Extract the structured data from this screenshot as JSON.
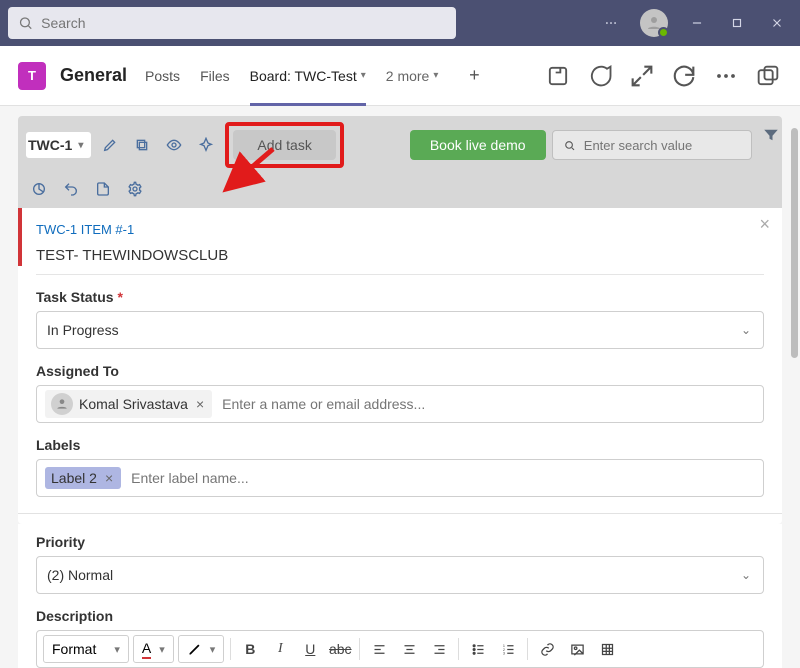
{
  "titlebar": {
    "search_placeholder": "Search"
  },
  "channel": {
    "icon_letter": "T",
    "name": "General",
    "tabs": {
      "posts": "Posts",
      "files": "Files",
      "board": "Board: TWC-Test",
      "more": "2 more"
    }
  },
  "toolbar": {
    "project": "TWC-1",
    "add_task": "Add task",
    "book_demo": "Book live demo",
    "search_placeholder": "Enter search value"
  },
  "task": {
    "item_id": "TWC-1 ITEM #-1",
    "title": "TEST- THEWINDOWSCLUB",
    "status_label": "Task Status",
    "status_value": "In Progress",
    "assigned_label": "Assigned To",
    "assignee": "Komal Srivastava",
    "assigned_placeholder": "Enter a name or email address...",
    "labels_label": "Labels",
    "label_chip": "Label 2",
    "labels_placeholder": "Enter label name...",
    "priority_label": "Priority",
    "priority_value": "(2) Normal",
    "description_label": "Description",
    "format_label": "Format",
    "font_letter": "A"
  }
}
